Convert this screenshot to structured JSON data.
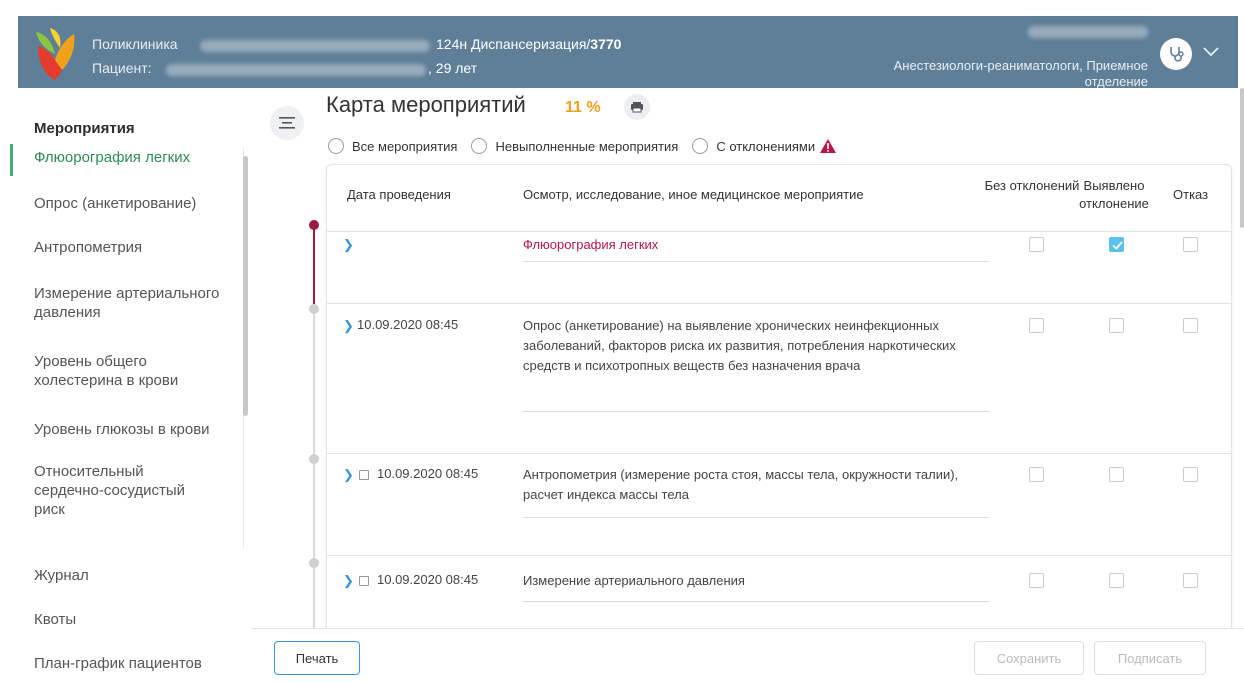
{
  "header": {
    "org_label": "Поликлиника",
    "patient_label": "Пациент:",
    "program": "124н Диспансеризация/",
    "program_id": "3770",
    "patient_age": ", 29 лет",
    "department": "Анестезиологи-реаниматологи, Приемное отделение"
  },
  "sidebar": {
    "heading": "Мероприятия",
    "items": [
      {
        "label": "Флюорография легких"
      },
      {
        "label": "Опрос (анкетирование)"
      },
      {
        "label": "Антропометрия"
      },
      {
        "label": "Измерение артериального давления"
      },
      {
        "label": "Уровень общего холестерина в крови"
      },
      {
        "label": "Уровень глюкозы в крови"
      },
      {
        "label": "Относительный сердечно-сосудистый риск"
      },
      {
        "label": "Журнал"
      },
      {
        "label": "Квоты"
      },
      {
        "label": "План-график пациентов"
      }
    ]
  },
  "main": {
    "title": "Карта мероприятий",
    "percent": "11 %",
    "filters": [
      "Все мероприятия",
      "Невыполненные мероприятия",
      "С отклонениями"
    ]
  },
  "table": {
    "headers": {
      "date": "Дата проведения",
      "desc": "Осмотр, исследование, иное медицинское мероприятие",
      "ok": "Без отклонений",
      "found": "Выявлено отклонение",
      "refuse": "Отказ"
    },
    "rows": [
      {
        "date": "",
        "desc": "Флюорография легких",
        "ok": false,
        "found": true,
        "refuse": false
      },
      {
        "date": "10.09.2020 08:45",
        "desc": "Опрос (анкетирование) на выявление хронических неинфекционных заболеваний, факторов риска их развития, потребления наркотических средств и психотропных веществ без назначения врача",
        "ok": false,
        "found": false,
        "refuse": false
      },
      {
        "date": "10.09.2020 08:45",
        "desc": "Антропометрия (измерение роста стоя, массы тела, окружности талии), расчет индекса массы тела",
        "ok": false,
        "found": false,
        "refuse": false
      },
      {
        "date": "10.09.2020 08:45",
        "desc": "Измерение артериального давления",
        "ok": false,
        "found": false,
        "refuse": false
      }
    ]
  },
  "footer": {
    "print": "Печать",
    "save": "Сохранить",
    "sign": "Подписать"
  },
  "colors": {
    "header_bg": "#5f7f98",
    "accent_green": "#2e8b57",
    "accent_red": "#b5174b",
    "percent": "#f0a020",
    "checkbox_checked": "#5bc0eb"
  }
}
